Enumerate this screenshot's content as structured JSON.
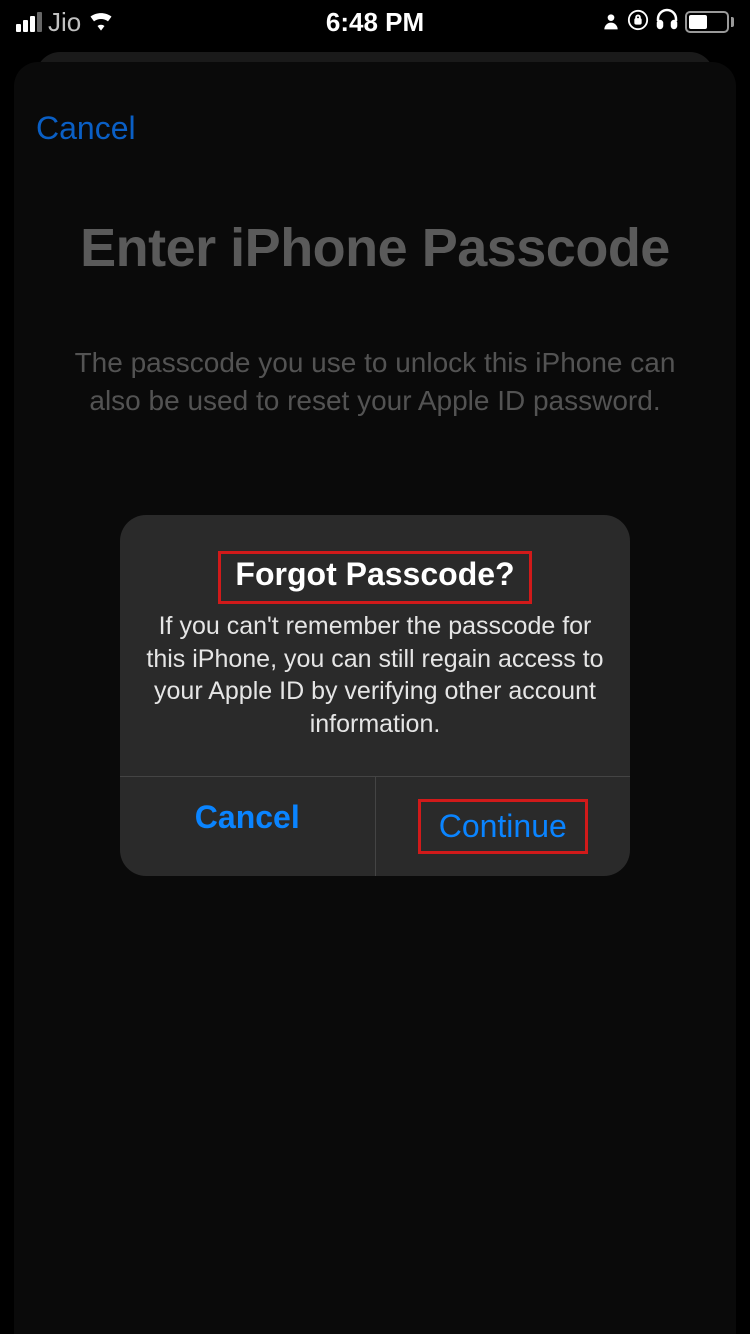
{
  "status_bar": {
    "carrier": "Jio",
    "time": "6:48 PM"
  },
  "sheet": {
    "cancel_link": "Cancel",
    "title": "Enter iPhone Passcode",
    "description": "The passcode you use to unlock this iPhone can also be used to reset your Apple ID password."
  },
  "alert": {
    "title": "Forgot Passcode?",
    "message": "If you can't remember the passcode for this iPhone, you can still regain access to your Apple ID by verifying other account information.",
    "cancel_button": "Cancel",
    "continue_button": "Continue"
  },
  "colors": {
    "accent": "#0a84ff",
    "highlight": "#d11a1a"
  }
}
